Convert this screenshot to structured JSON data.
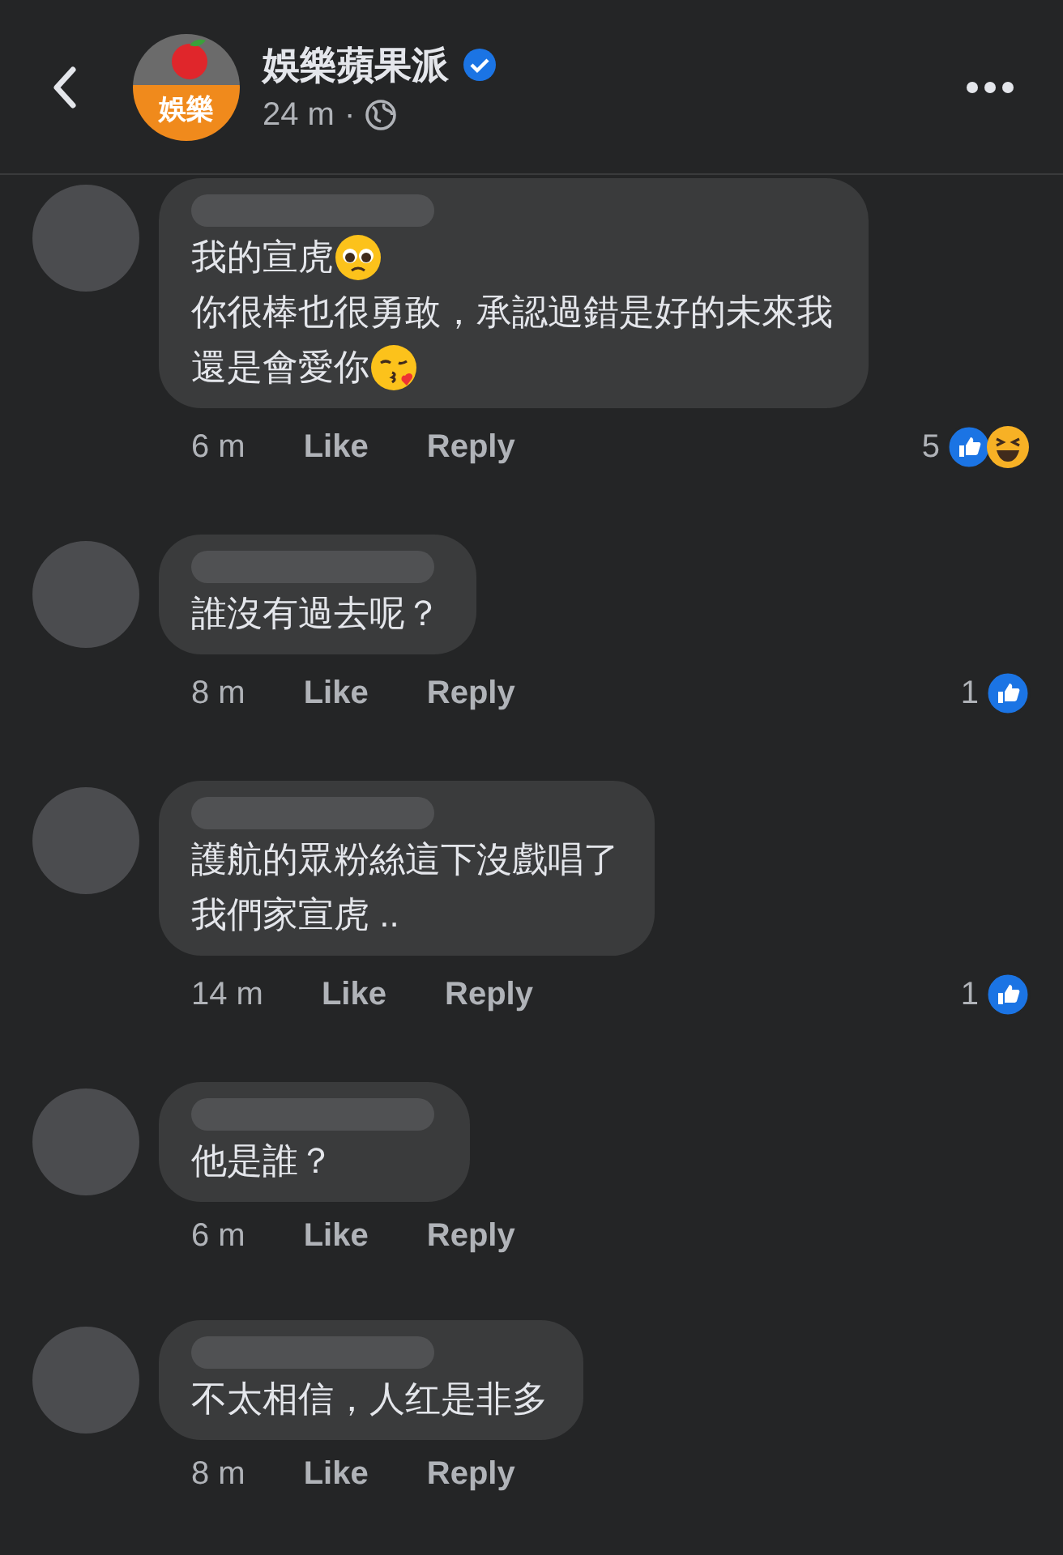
{
  "header": {
    "title": "娛樂蘋果派",
    "avatar_text": "娛樂",
    "verified": true,
    "time": "24 m",
    "separator": "·"
  },
  "comments": [
    {
      "lines": [
        {
          "text": "我的宣虎",
          "emoji": {
            "kind": "pleading"
          }
        },
        {
          "text": "你很棒也很勇敢，承認過錯是好的未來我"
        },
        {
          "text": "還是會愛你",
          "emoji": {
            "kind": "kiss"
          }
        }
      ],
      "time": "6 m",
      "like": "Like",
      "reply": "Reply",
      "count": "5",
      "reactions": [
        {
          "kind": "like"
        },
        {
          "kind": "haha"
        }
      ]
    },
    {
      "lines": [
        {
          "text": "誰沒有過去呢？"
        }
      ],
      "time": "8 m",
      "like": "Like",
      "reply": "Reply",
      "count": "1",
      "reactions": [
        {
          "kind": "like"
        }
      ]
    },
    {
      "lines": [
        {
          "text": "護航的眾粉絲這下沒戲唱了"
        },
        {
          "text": "我們家宣虎 .."
        }
      ],
      "time": "14 m",
      "like": "Like",
      "reply": "Reply",
      "count": "1",
      "reactions": [
        {
          "kind": "like"
        }
      ]
    },
    {
      "lines": [
        {
          "text": "他是誰？"
        }
      ],
      "time": "6 m",
      "like": "Like",
      "reply": "Reply"
    },
    {
      "lines": [
        {
          "text": "不太相信，人红是非多"
        }
      ],
      "time": "8 m",
      "like": "Like",
      "reply": "Reply"
    }
  ]
}
